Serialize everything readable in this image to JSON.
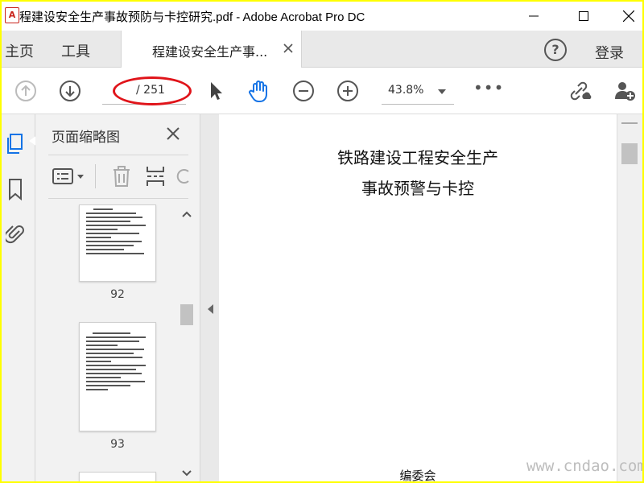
{
  "window": {
    "title": "程建设安全生产事故预防与卡控研究.pdf - Adobe Acrobat Pro DC",
    "app_icon_glyph": "A",
    "controls": [
      "minimize-icon",
      "maximize-icon",
      "close-icon"
    ]
  },
  "tabs": {
    "home": "主页",
    "tools": "工具",
    "document": "程建设安全生产事...",
    "help": "?",
    "login": "登录"
  },
  "toolbar": {
    "page_current": "",
    "page_total": "/ 251",
    "zoom": "43.8%",
    "more": "•••",
    "icons": [
      "prev-page-icon",
      "next-page-icon",
      "select-cursor-icon",
      "hand-tool-icon",
      "zoom-out-icon",
      "zoom-in-icon",
      "share-link-icon",
      "add-user-icon"
    ],
    "highlight_color": "#e0141a"
  },
  "thumbnails_panel": {
    "title": "页面缩略图",
    "pages": [
      {
        "number": "92"
      },
      {
        "number": "93"
      }
    ]
  },
  "document": {
    "title_line1": "铁路建设工程安全生产",
    "title_line2": "事故预警与卡控",
    "footer": "编委会"
  },
  "watermark": "www.cndao.com",
  "colors": {
    "frame_border": "#ffff00",
    "active_icon": "#1473e6"
  }
}
